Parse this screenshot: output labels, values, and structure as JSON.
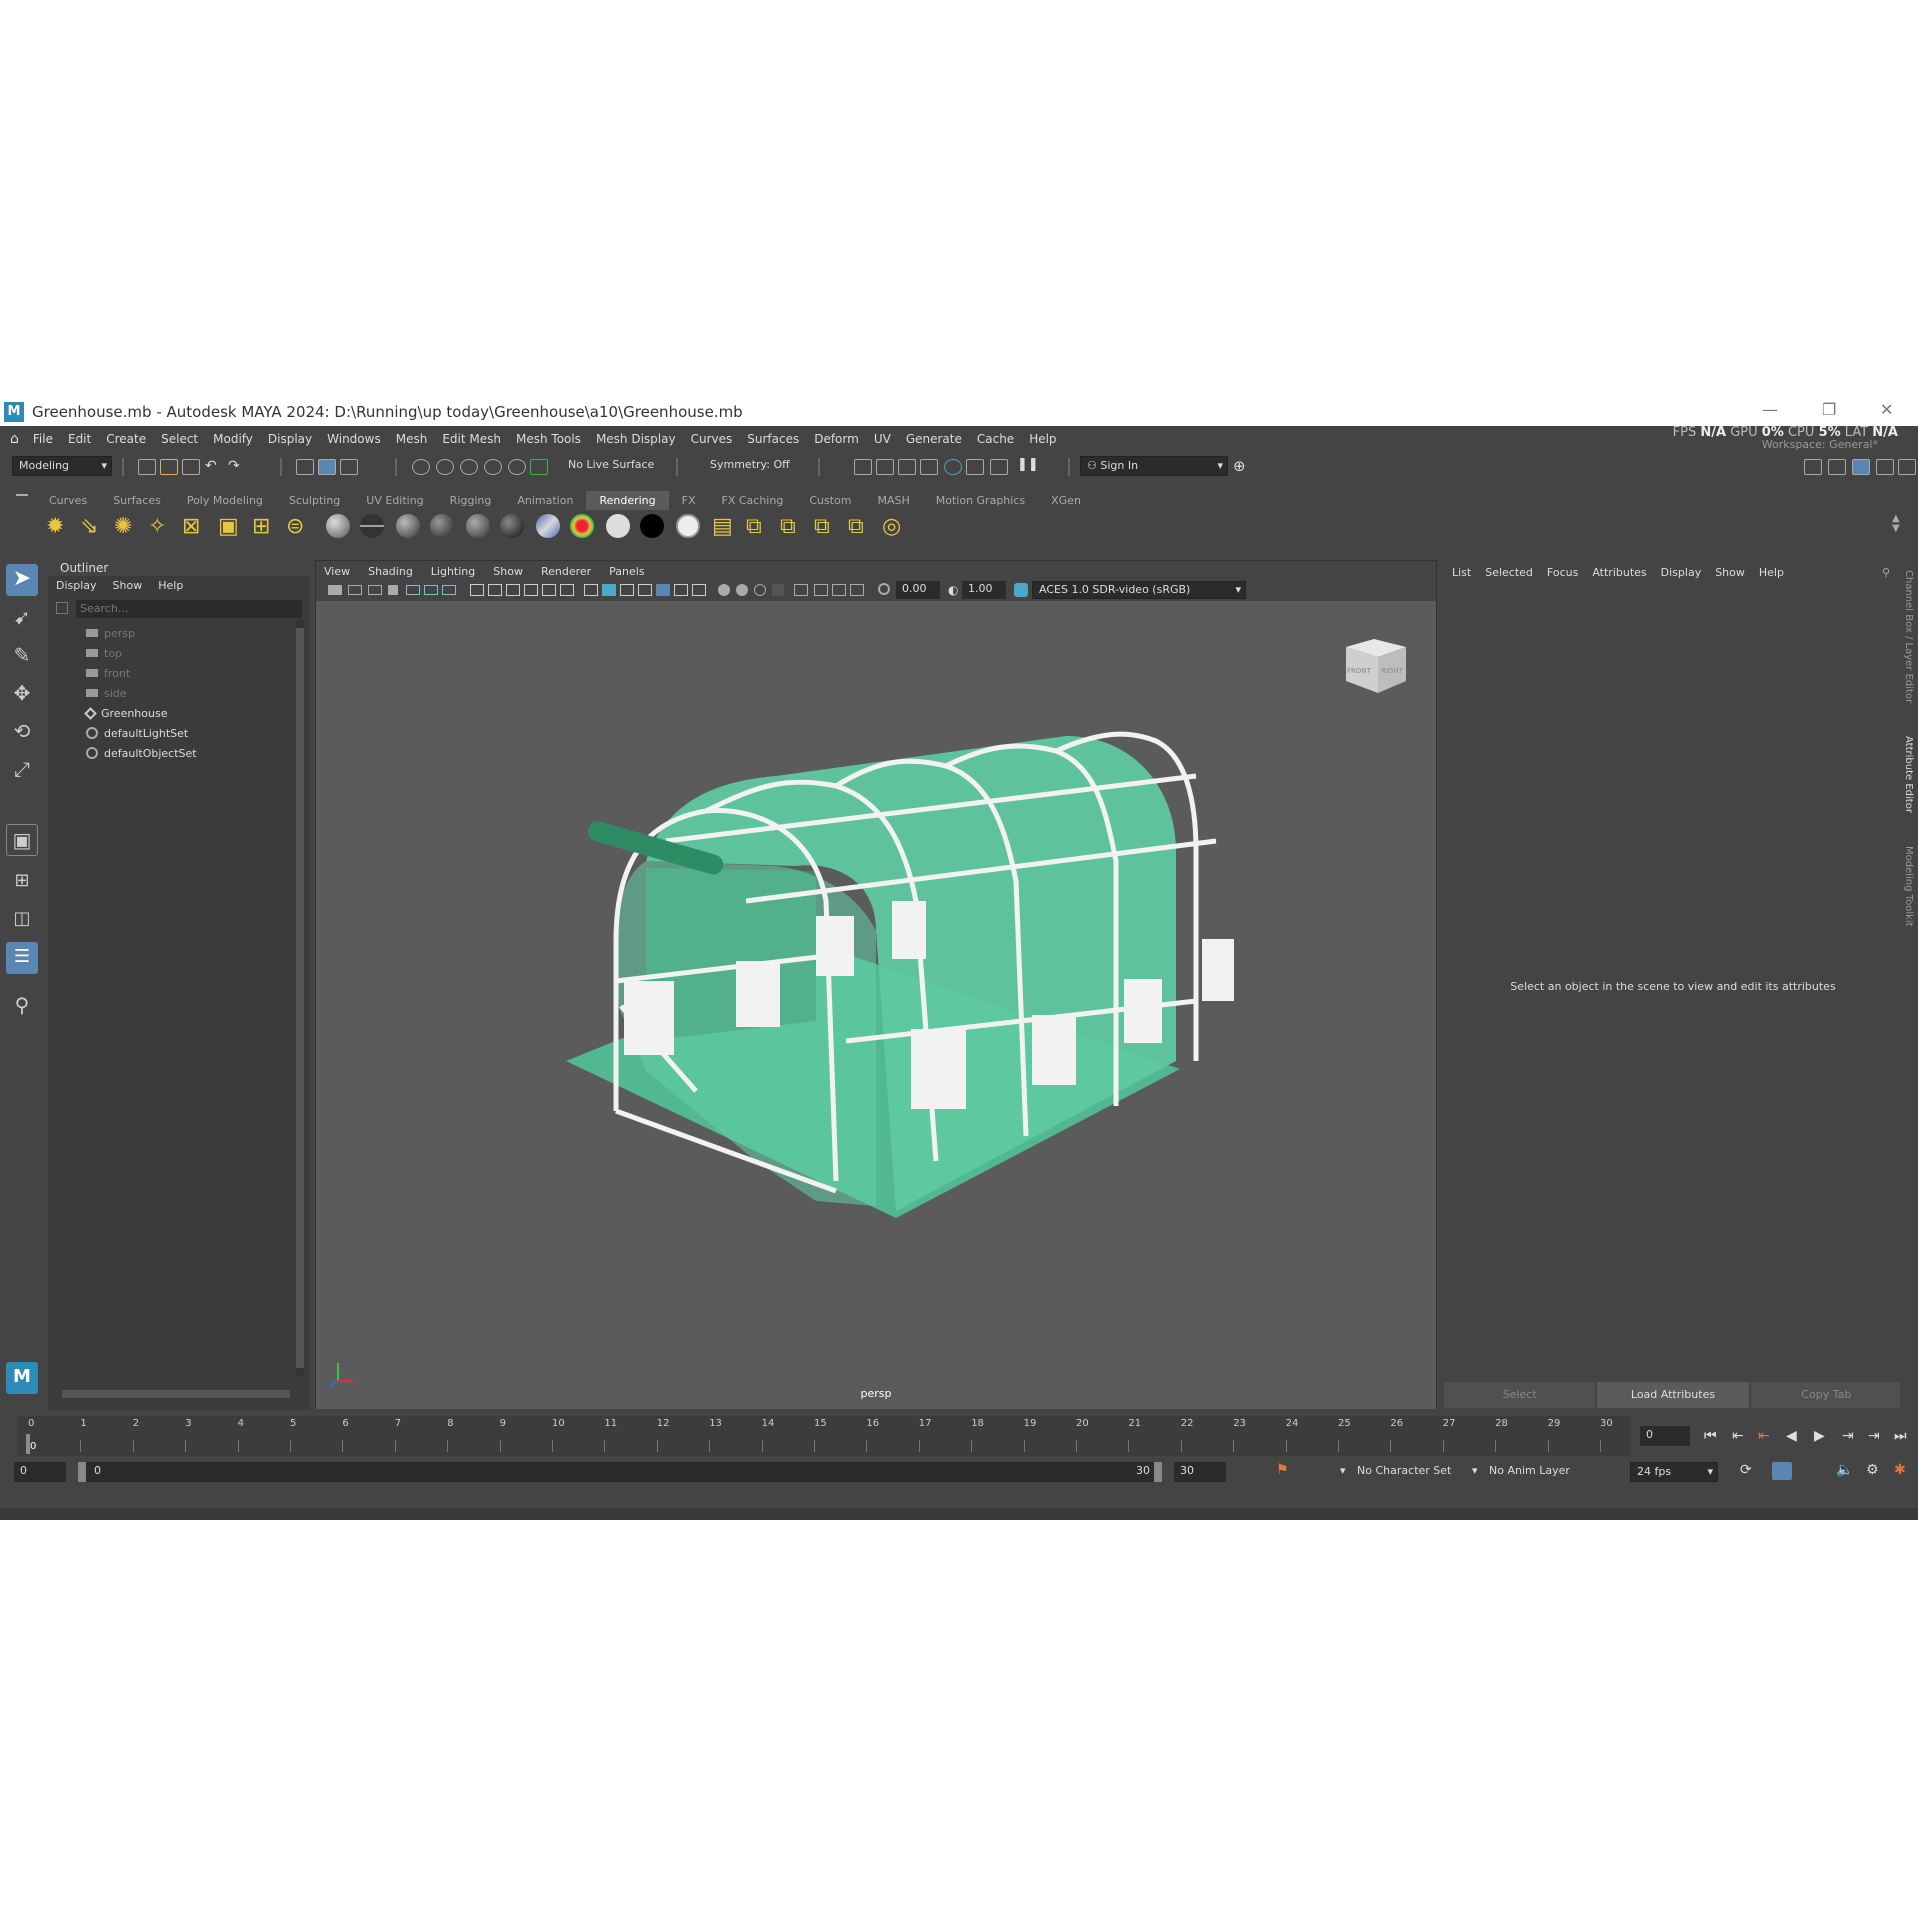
{
  "window": {
    "title": "Greenhouse.mb - Autodesk MAYA 2024: D:\\Running\\up today\\Greenhouse\\a10\\Greenhouse.mb",
    "logo": "M",
    "minimize": "—",
    "restore": "❐",
    "close": "✕"
  },
  "menubar": {
    "items": [
      "File",
      "Edit",
      "Create",
      "Select",
      "Modify",
      "Display",
      "Windows",
      "Mesh",
      "Edit Mesh",
      "Mesh Tools",
      "Mesh Display",
      "Curves",
      "Surfaces",
      "Deform",
      "UV",
      "Generate",
      "Cache",
      "Help"
    ],
    "perf": {
      "fps_label": "FPS",
      "fps": "N/A",
      "gpu_label": "GPU",
      "gpu": "0%",
      "cpu_label": "CPU",
      "cpu": "5%",
      "lat_label": "LAT",
      "lat": "N/A"
    },
    "workspace_label": "Workspace:",
    "workspace_value": "General*"
  },
  "statusline": {
    "mode": "Modeling",
    "live_surface": "No Live Surface",
    "symmetry": "Symmetry: Off",
    "sign_in": "Sign In"
  },
  "shelf": {
    "tabs": [
      "Curves",
      "Surfaces",
      "Poly Modeling",
      "Sculpting",
      "UV Editing",
      "Rigging",
      "Animation",
      "Rendering",
      "FX",
      "FX Caching",
      "Custom",
      "MASH",
      "Motion Graphics",
      "XGen"
    ],
    "active_tab": "Rendering"
  },
  "outliner": {
    "title": "Outliner",
    "menu": [
      "Display",
      "Show",
      "Help"
    ],
    "search_placeholder": "Search...",
    "items": [
      {
        "label": "persp",
        "icon": "camera-icon",
        "dim": true
      },
      {
        "label": "top",
        "icon": "camera-icon",
        "dim": true
      },
      {
        "label": "front",
        "icon": "camera-icon",
        "dim": true
      },
      {
        "label": "side",
        "icon": "camera-icon",
        "dim": true
      },
      {
        "label": "Greenhouse",
        "icon": "transform-icon",
        "dim": false
      },
      {
        "label": "defaultLightSet",
        "icon": "set-icon",
        "dim": false
      },
      {
        "label": "defaultObjectSet",
        "icon": "set-icon",
        "dim": false
      }
    ]
  },
  "viewport": {
    "menu": [
      "View",
      "Shading",
      "Lighting",
      "Show",
      "Renderer",
      "Panels"
    ],
    "exposure": "0.00",
    "gamma": "1.00",
    "color_space": "ACES 1.0 SDR-video (sRGB)",
    "camera_label": "persp",
    "viewcube_front": "FRONT",
    "viewcube_right": "RIGHT",
    "model_color": "#5fc9a0"
  },
  "attribute_editor": {
    "menu": [
      "List",
      "Selected",
      "Focus",
      "Attributes",
      "Display",
      "Show",
      "Help"
    ],
    "message": "Select an object in the scene to view and edit its attributes",
    "buttons": [
      "Select",
      "Load Attributes",
      "Copy Tab"
    ],
    "side_tabs": [
      "Channel Box / Layer Editor",
      "Attribute Editor",
      "Modeling Toolkit"
    ]
  },
  "timeline": {
    "ticks": [
      "0",
      "1",
      "2",
      "3",
      "4",
      "5",
      "6",
      "7",
      "8",
      "9",
      "10",
      "11",
      "12",
      "13",
      "14",
      "15",
      "16",
      "17",
      "18",
      "19",
      "20",
      "21",
      "22",
      "23",
      "24",
      "25",
      "26",
      "27",
      "28",
      "29",
      "30"
    ],
    "current_frame": "0",
    "current_frame_field": "0"
  },
  "range": {
    "start": "0",
    "inner_start": "0",
    "inner_end": "30",
    "end": "30",
    "character_set": "No Character Set",
    "anim_layer": "No Anim Layer",
    "fps": "24 fps"
  }
}
